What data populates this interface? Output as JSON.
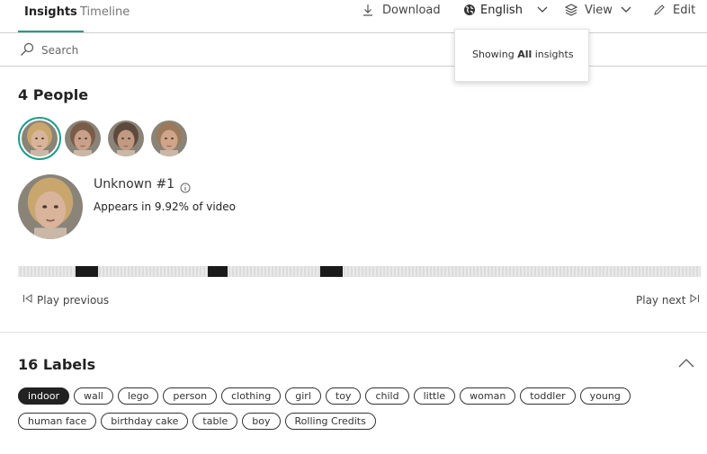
{
  "tabs": [
    {
      "label": "Insights",
      "active": true
    },
    {
      "label": "Timeline",
      "active": false
    }
  ],
  "toolbar": {
    "download_label": "Download",
    "language_label": "English",
    "view_label": "View",
    "edit_label": "Edit"
  },
  "search": {
    "placeholder": "Search"
  },
  "popup": {
    "prefix": "Showing ",
    "bold": "All",
    "suffix": " insights"
  },
  "people": {
    "title": "4 People",
    "avatars": [
      {
        "name": "avatar-1",
        "hair": "#c8a66e",
        "face": "#d9b49a",
        "selected": true
      },
      {
        "name": "avatar-2",
        "hair": "#7a5c48",
        "face": "#c9a08a",
        "selected": false
      },
      {
        "name": "avatar-3",
        "hair": "#5e4a3c",
        "face": "#c29a82",
        "selected": false
      },
      {
        "name": "avatar-4",
        "hair": "#9a7a5a",
        "face": "#cfa58a",
        "selected": false
      }
    ],
    "selected_person": {
      "name": "Unknown #1",
      "appears": "Appears in 9.92% of video"
    },
    "timeline_segments": [
      {
        "start": 0.084,
        "end": 0.117
      },
      {
        "start": 0.278,
        "end": 0.307
      },
      {
        "start": 0.443,
        "end": 0.476
      }
    ],
    "play_previous": "Play previous",
    "play_next": "Play next"
  },
  "labels": {
    "title": "16 Labels",
    "rows": [
      [
        {
          "label": "indoor",
          "active": true
        },
        {
          "label": "wall",
          "active": false
        },
        {
          "label": "lego",
          "active": false
        },
        {
          "label": "person",
          "active": false
        },
        {
          "label": "clothing",
          "active": false
        },
        {
          "label": "girl",
          "active": false
        },
        {
          "label": "toy",
          "active": false
        },
        {
          "label": "child",
          "active": false
        },
        {
          "label": "little",
          "active": false
        },
        {
          "label": "woman",
          "active": false
        },
        {
          "label": "toddler",
          "active": false
        },
        {
          "label": "young",
          "active": false
        }
      ],
      [
        {
          "label": "human face",
          "active": false
        },
        {
          "label": "birthday cake",
          "active": false
        },
        {
          "label": "table",
          "active": false
        },
        {
          "label": "boy",
          "active": false
        },
        {
          "label": "Rolling Credits",
          "active": false
        }
      ]
    ]
  },
  "colors": {
    "accent": "#1f9e89",
    "segment": "#1a1a1a",
    "chip_active": "#222222"
  },
  "icons": [
    "download-icon",
    "globe-icon",
    "chevron-down-icon",
    "layers-icon",
    "pencil-icon",
    "search-icon",
    "info-icon",
    "play-previous-icon",
    "play-next-icon",
    "chevron-up-icon"
  ]
}
